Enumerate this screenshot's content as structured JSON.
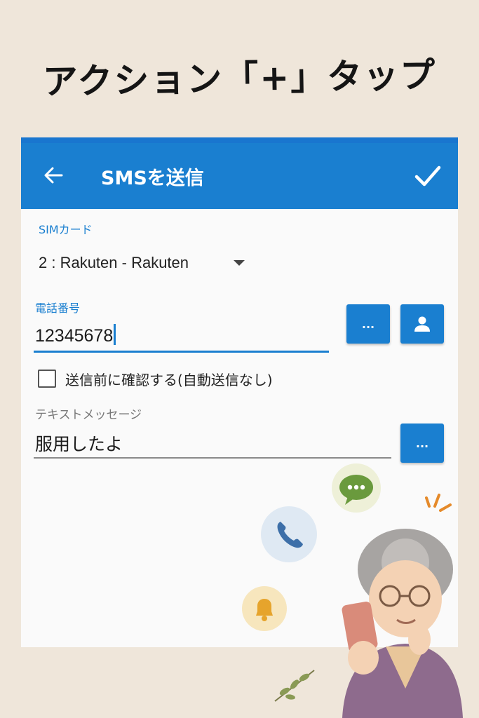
{
  "headline": "アクション「+」タップ",
  "appbar": {
    "title": "SMSを送信",
    "back_icon": "arrow-left-icon",
    "confirm_icon": "check-icon"
  },
  "sim": {
    "label": "SIMカード",
    "value": "2 : Rakuten - Rakuten"
  },
  "phone_number": {
    "label": "電話番号",
    "value": "12345678",
    "picker_button": "...",
    "contact_icon": "person-icon"
  },
  "confirm_option": {
    "label": "送信前に確認する(自動送信なし)",
    "checked": false
  },
  "message": {
    "label": "テキストメッセージ",
    "value": "服用したよ",
    "picker_button": "..."
  },
  "colors": {
    "accent": "#1a7fd0",
    "background": "#efe6da",
    "screen": "#fafafa"
  }
}
